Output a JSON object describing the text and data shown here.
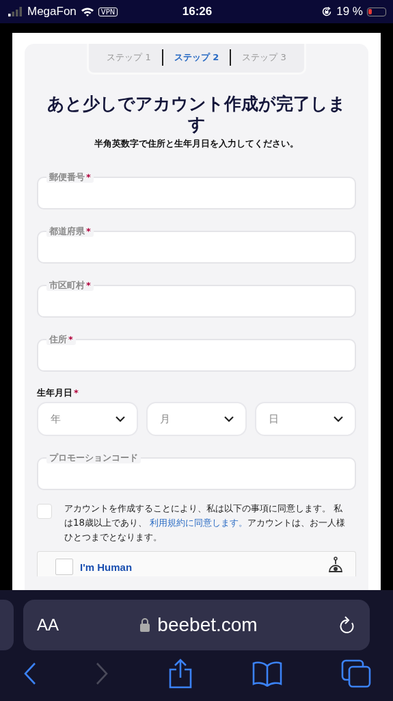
{
  "status_bar": {
    "carrier": "MegaFon",
    "vpn": "VPN",
    "time": "16:26",
    "battery": "19 %"
  },
  "steps": [
    {
      "label": "ステップ 1",
      "selected": false
    },
    {
      "label": "ステップ 2",
      "selected": true
    },
    {
      "label": "ステップ 3",
      "selected": false
    }
  ],
  "title": "あと少しでアカウント作成が完了します",
  "subtitle": "半角英数字で住所と生年月日を入力してください。",
  "fields": [
    {
      "label": "郵便番号",
      "required_mark": "*"
    },
    {
      "label": "都道府県",
      "required_mark": "*"
    },
    {
      "label": "市区町村",
      "required_mark": "*"
    },
    {
      "label": "住所",
      "required_mark": "*"
    }
  ],
  "birthdate": {
    "label": "生年月日",
    "required_mark": "*",
    "selects": [
      {
        "placeholder": "年"
      },
      {
        "placeholder": "月"
      },
      {
        "placeholder": "日"
      }
    ]
  },
  "promo_field": {
    "label": "プロモーションコード"
  },
  "consent": {
    "checked": false,
    "text_before": "アカウントを作成することにより、私は以下の事項に同意します。 私は18歳以上であり、",
    "link": "利用規約に同意します。",
    "text_after": "アカウントは、お一人様ひとつまでとなります。"
  },
  "captcha": {
    "label": "I'm Human",
    "checked": false
  },
  "browser": {
    "text_size": "AA",
    "url": "beebet.com",
    "forward_disabled": true
  }
}
